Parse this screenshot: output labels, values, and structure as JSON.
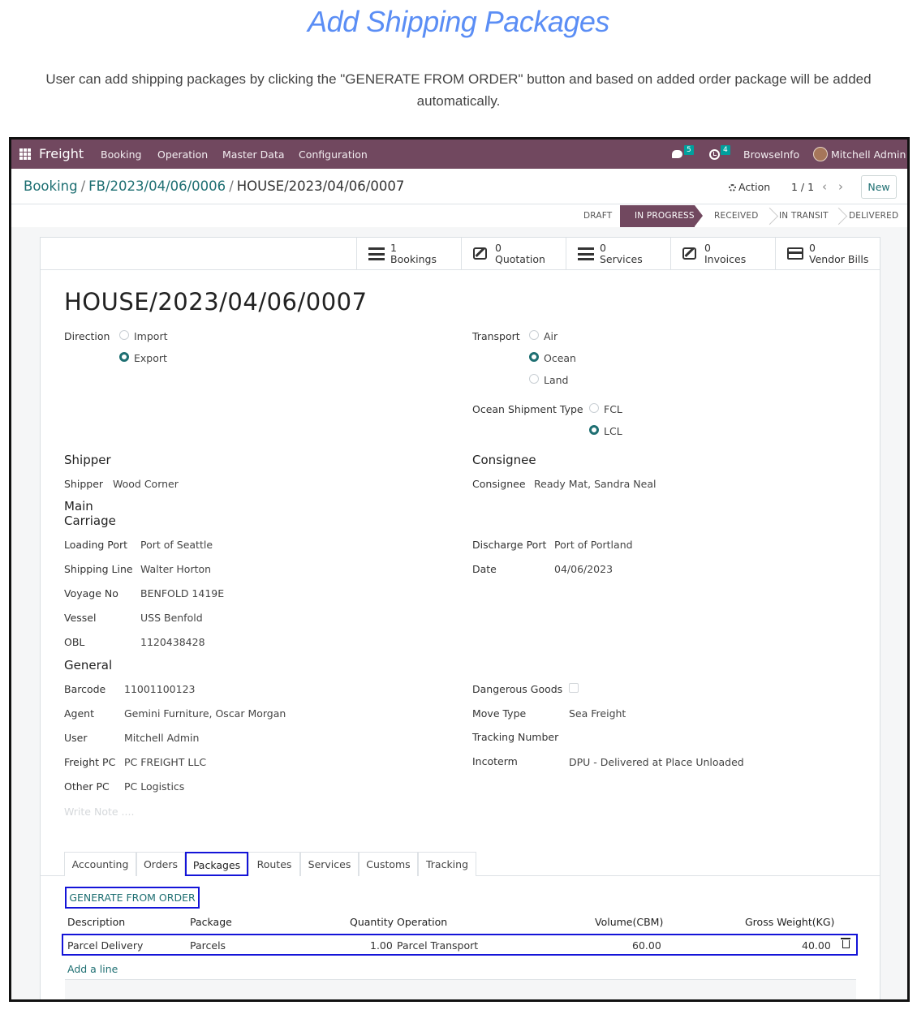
{
  "doc": {
    "title": "Add Shipping Packages",
    "description": "User can add shipping packages by clicking the \"GENERATE FROM ORDER\" button and based on added order package will be added automatically."
  },
  "navbar": {
    "brand": "Freight",
    "menu": [
      "Booking",
      "Operation",
      "Master Data",
      "Configuration"
    ],
    "messages_count": "5",
    "activities_count": "4",
    "company": "BrowseInfo",
    "user": "Mitchell Admin"
  },
  "breadcrumb": [
    "Booking",
    "FB/2023/04/06/0006",
    "HOUSE/2023/04/06/0007"
  ],
  "controls": {
    "action": "Action",
    "pager": "1 / 1",
    "new": "New"
  },
  "status": {
    "stages": [
      "DRAFT",
      "IN PROGRESS",
      "RECEIVED",
      "IN TRANSIT",
      "DELIVERED"
    ],
    "active": "IN PROGRESS"
  },
  "smart_buttons": [
    {
      "count": "1",
      "label": "Bookings",
      "icon": "list-icon"
    },
    {
      "count": "0",
      "label": "Quotation",
      "icon": "edit-icon"
    },
    {
      "count": "0",
      "label": "Services",
      "icon": "list-icon"
    },
    {
      "count": "0",
      "label": "Invoices",
      "icon": "edit-icon"
    },
    {
      "count": "0",
      "label": "Vendor Bills",
      "icon": "card-icon"
    }
  ],
  "record": {
    "title": "HOUSE/2023/04/06/0007",
    "direction": {
      "label": "Direction",
      "options": [
        "Import",
        "Export"
      ],
      "selected": "Export"
    },
    "transport": {
      "label": "Transport",
      "options": [
        "Air",
        "Ocean",
        "Land"
      ],
      "selected": "Ocean"
    },
    "ocean_type": {
      "label": "Ocean Shipment Type",
      "options": [
        "FCL",
        "LCL"
      ],
      "selected": "LCL"
    },
    "shipper_group": "Shipper",
    "shipper": {
      "label": "Shipper",
      "value": "Wood Corner"
    },
    "consignee_group": "Consignee",
    "consignee": {
      "label": "Consignee",
      "value": "Ready Mat, Sandra Neal"
    },
    "main_carriage_line1": "Main",
    "main_carriage_line2": "Carriage",
    "loading_port": {
      "label": "Loading Port",
      "value": "Port of Seattle"
    },
    "shipping_line": {
      "label": "Shipping Line",
      "value": "Walter Horton"
    },
    "voyage_no": {
      "label": "Voyage No",
      "value": "BENFOLD 1419E"
    },
    "vessel": {
      "label": "Vessel",
      "value": "USS Benfold"
    },
    "obl": {
      "label": "OBL",
      "value": "1120438428"
    },
    "discharge_port": {
      "label": "Discharge Port",
      "value": "Port of Portland"
    },
    "date": {
      "label": "Date",
      "value": "04/06/2023"
    },
    "general_group": "General",
    "barcode": {
      "label": "Barcode",
      "value": "11001100123"
    },
    "agent": {
      "label": "Agent",
      "value": "Gemini Furniture, Oscar Morgan"
    },
    "user": {
      "label": "User",
      "value": "Mitchell Admin"
    },
    "freight_pc": {
      "label": "Freight PC",
      "value": "PC FREIGHT LLC"
    },
    "other_pc": {
      "label": "Other PC",
      "value": "PC Logistics"
    },
    "dangerous_goods": {
      "label": "Dangerous Goods",
      "checked": false
    },
    "move_type": {
      "label": "Move Type",
      "value": "Sea Freight"
    },
    "tracking_number": {
      "label": "Tracking Number",
      "value": ""
    },
    "incoterm": {
      "label": "Incoterm",
      "value": "DPU - Delivered at Place Unloaded"
    },
    "note_placeholder": "Write Note ...."
  },
  "tabs": [
    "Accounting",
    "Orders",
    "Packages",
    "Routes",
    "Services",
    "Customs",
    "Tracking"
  ],
  "active_tab": "Packages",
  "packages": {
    "generate_label": "GENERATE FROM ORDER",
    "columns": [
      "Description",
      "Package",
      "Quantity",
      "Operation",
      "Volume(CBM)",
      "Gross Weight(KG)"
    ],
    "rows": [
      {
        "description": "Parcel Delivery",
        "package": "Parcels",
        "quantity": "1.00",
        "operation": "Parcel Transport",
        "volume": "60.00",
        "weight": "40.00"
      }
    ],
    "add_line": "Add a line"
  },
  "colors": {
    "navbar": "#71485f",
    "accent": "#1e6f72",
    "highlight": "#1414d8",
    "title": "#5b8ef5"
  }
}
